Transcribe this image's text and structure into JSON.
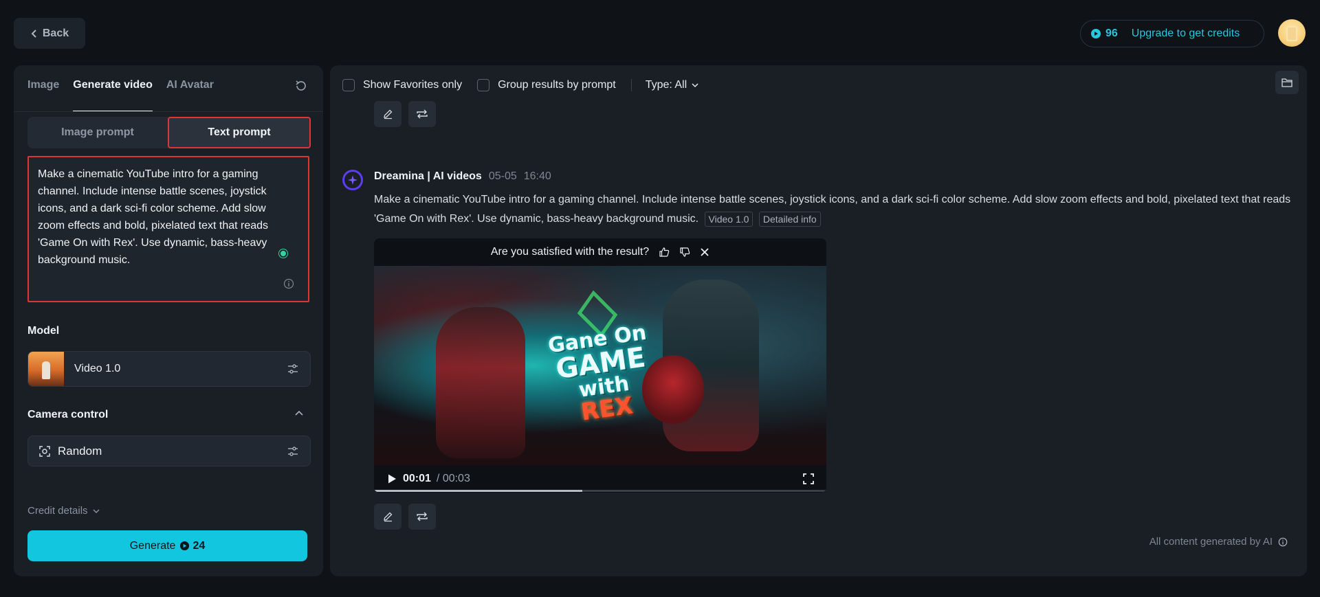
{
  "header": {
    "back_label": "Back",
    "credits_count": "96",
    "upgrade_label": "Upgrade to get credits"
  },
  "left": {
    "tabs": [
      {
        "label": "Image"
      },
      {
        "label": "Generate video"
      },
      {
        "label": "AI Avatar"
      }
    ],
    "prompt_switch": {
      "image_prompt": "Image prompt",
      "text_prompt": "Text prompt",
      "active": "Text prompt"
    },
    "prompt_value": "Make a cinematic YouTube intro for a gaming channel. Include intense battle scenes, joystick icons, and a dark sci-fi color scheme. Add slow zoom effects and bold, pixelated text that reads 'Game On with Rex'. Use dynamic, bass-heavy background music.",
    "model_label": "Model",
    "model_name": "Video 1.0",
    "camera_label": "Camera control",
    "camera_value": "Random",
    "credit_details": "Credit details",
    "generate_label": "Generate",
    "generate_cost": "24"
  },
  "main": {
    "filters": {
      "favorites": "Show Favorites only",
      "group": "Group results by prompt",
      "type": "Type: All"
    },
    "result": {
      "source": "Dreamina | AI videos",
      "date": "05-05",
      "time": "16:40",
      "prompt": "Make a cinematic YouTube intro for a gaming channel. Include intense battle scenes, joystick icons, and a dark sci-fi color scheme. Add slow zoom effects and bold, pixelated text that reads 'Game On with Rex'. Use dynamic, bass-heavy background music.",
      "tag_model": "Video 1.0",
      "tag_info": "Detailed info"
    },
    "video": {
      "satisfaction_question": "Are you satisfied with the result?",
      "overlay_text": [
        "Gane On",
        "GAME",
        "with",
        "REX"
      ],
      "current_time": "00:01",
      "total_time": "/ 00:03",
      "progress": 0.46
    },
    "footer_note": "All content generated by AI"
  },
  "colors": {
    "accent": "#12c6df",
    "highlight_border": "#e03535",
    "background": "#0f1318",
    "panel": "#1a1f26"
  }
}
